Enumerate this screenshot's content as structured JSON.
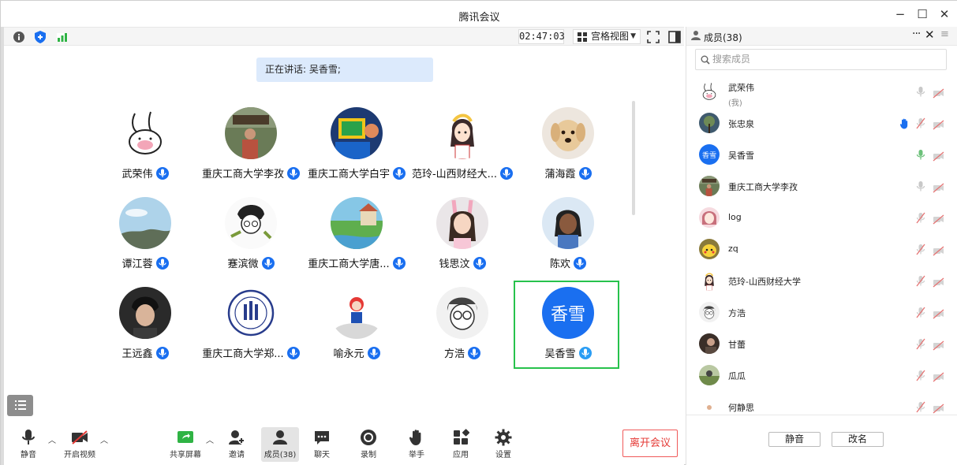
{
  "window": {
    "title": "腾讯会议"
  },
  "toolbar": {
    "timer": "02:47:03",
    "view_label": "宫格视图"
  },
  "speaking": {
    "text": "正在讲话: 吴香雪;"
  },
  "grid": [
    {
      "name": "武荣伟",
      "avatar": "rabbit"
    },
    {
      "name": "重庆工商大学李孜",
      "avatar": "person-garden"
    },
    {
      "name": "重庆工商大学白宇",
      "avatar": "kid-computer"
    },
    {
      "name": "范玲-山西财经大...",
      "avatar": "anime-girl"
    },
    {
      "name": "蒲海霞",
      "avatar": "puppy"
    },
    {
      "name": "谭江蓉",
      "avatar": "sky-landscape"
    },
    {
      "name": "蹇滨微",
      "avatar": "sketch-person"
    },
    {
      "name": "重庆工商大学唐...",
      "avatar": "painted-town"
    },
    {
      "name": "钱思汶",
      "avatar": "girl-bunny-ears"
    },
    {
      "name": "陈欢",
      "avatar": "cartoon-girl"
    },
    {
      "name": "王远鑫",
      "avatar": "young-man"
    },
    {
      "name": "重庆工商大学郑...",
      "avatar": "university-logo"
    },
    {
      "name": "喻永元",
      "avatar": "figurine"
    },
    {
      "name": "方浩",
      "avatar": "manga-boy"
    },
    {
      "name": "吴香雪",
      "avatar": "text-avatar",
      "avatar_text": "香雪",
      "active": true
    }
  ],
  "bottom": {
    "mute": "静音",
    "video": "开启视频",
    "share": "共享屏幕",
    "invite": "邀请",
    "members": "成员(38)",
    "chat": "聊天",
    "record": "录制",
    "raise": "举手",
    "apps": "应用",
    "settings": "设置",
    "leave": "离开会议"
  },
  "side": {
    "title": "成员(38)",
    "search_placeholder": "搜索成员",
    "members": [
      {
        "name": "武荣伟",
        "sub": "(我)",
        "avatar": "rabbit",
        "mic": "off-gray",
        "hand": false
      },
      {
        "name": "张忠泉",
        "avatar": "tree",
        "mic": "muted",
        "hand": true
      },
      {
        "name": "吴香雪",
        "avatar": "text-avatar",
        "avatar_text": "香雪",
        "mic": "speaking"
      },
      {
        "name": "重庆工商大学李孜",
        "avatar": "person-garden",
        "mic": "off-gray"
      },
      {
        "name": "log",
        "avatar": "pink-anime",
        "mic": "muted"
      },
      {
        "name": "zq",
        "avatar": "pikachu",
        "mic": "muted"
      },
      {
        "name": "范玲-山西财经大学",
        "avatar": "anime-girl",
        "mic": "muted"
      },
      {
        "name": "方浩",
        "avatar": "manga-boy",
        "mic": "muted"
      },
      {
        "name": "甘蕾",
        "avatar": "dark-photo",
        "mic": "muted"
      },
      {
        "name": "瓜瓜",
        "avatar": "field-photo",
        "mic": "muted"
      },
      {
        "name": "何静思",
        "avatar": "small-figure",
        "mic": "muted"
      }
    ],
    "mute_all": "静音",
    "rename": "改名"
  },
  "colors": {
    "accent": "#1a6ff0",
    "active_border": "#27c24c",
    "leave": "#e53935"
  }
}
